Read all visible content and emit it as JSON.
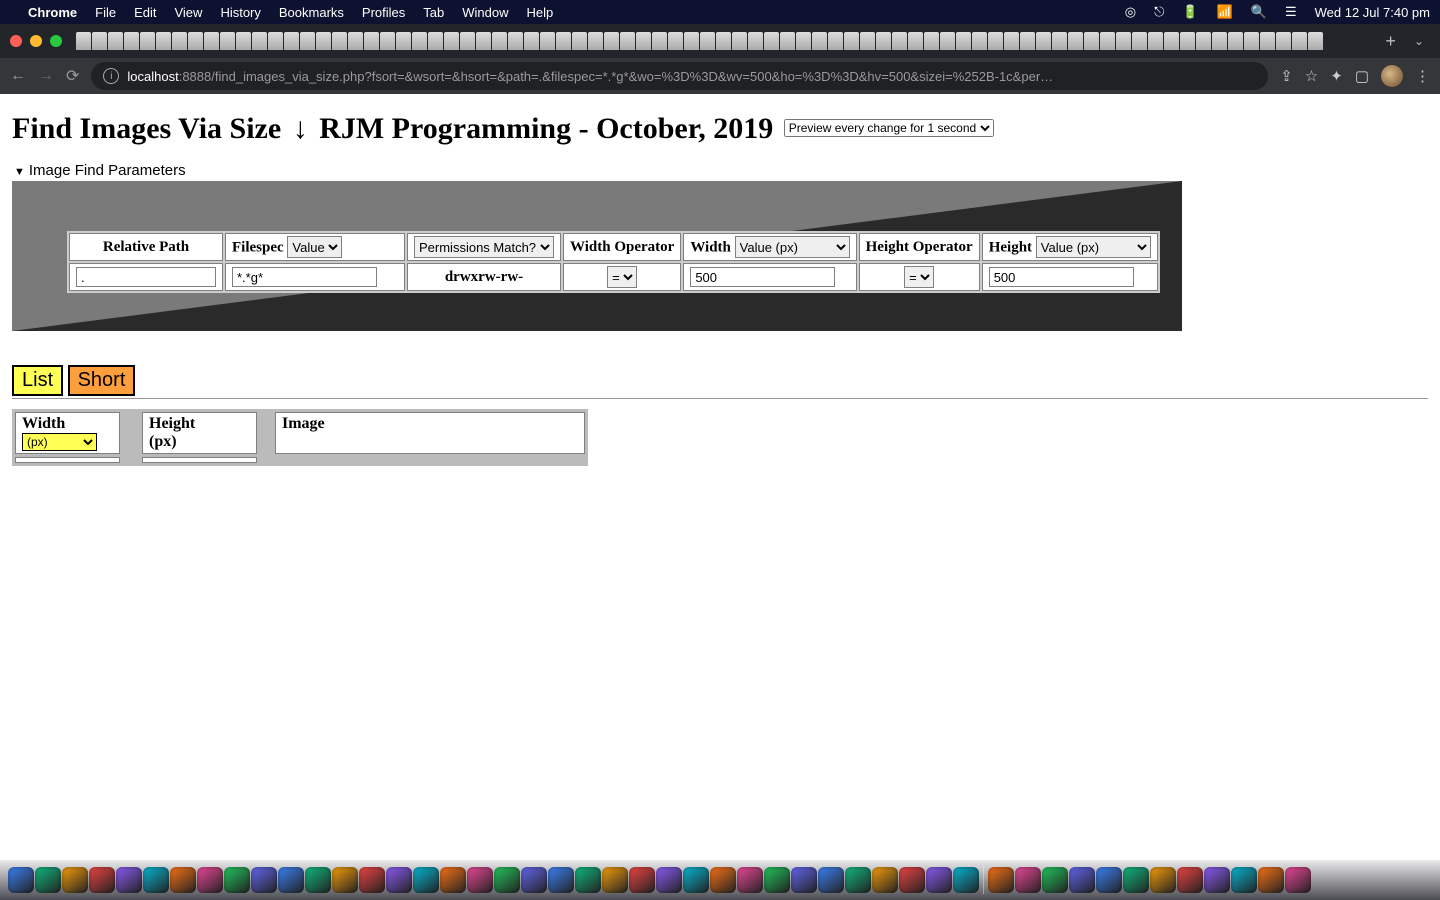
{
  "menubar": {
    "app": "Chrome",
    "items": [
      "File",
      "Edit",
      "View",
      "History",
      "Bookmarks",
      "Profiles",
      "Tab",
      "Window",
      "Help"
    ],
    "clock": "Wed 12 Jul  7:40 pm"
  },
  "toolbar": {
    "url_host": "localhost",
    "url_port": ":8888",
    "url_path": "/find_images_via_size.php?fsort=&wsort=&hsort=&path=.&filespec=*.*g*&wo=%3D%3D&wv=500&ho=%3D%3D&hv=500&sizei=%252B-1c&per…"
  },
  "page": {
    "title_left": "Find Images Via Size",
    "title_arrow": "↓",
    "title_right": "RJM Programming - October, 2019",
    "preview_select": "Preview every change for 1 second",
    "details_summary": "Image Find Parameters"
  },
  "params": {
    "headers": {
      "relpath": "Relative Path",
      "filespec": "Filespec",
      "filespec_sel": "Value",
      "perm": "Permissions Match?",
      "wop": "Width Operator",
      "width": "Width",
      "width_sel": "Value (px)",
      "hop": "Height Operator",
      "height": "Height",
      "height_sel": "Value (px)"
    },
    "values": {
      "relpath": ".",
      "filespec": "*.*g*",
      "perm": "drwxrw-rw-",
      "wop": "=",
      "width": "500",
      "hop": "=",
      "height": "500"
    }
  },
  "buttons": {
    "list": "List",
    "short": "Short"
  },
  "results": {
    "width_label": "Width",
    "width_unit": "(px)",
    "height_label": "Height",
    "height_unit": "(px)",
    "image_label": "Image"
  }
}
